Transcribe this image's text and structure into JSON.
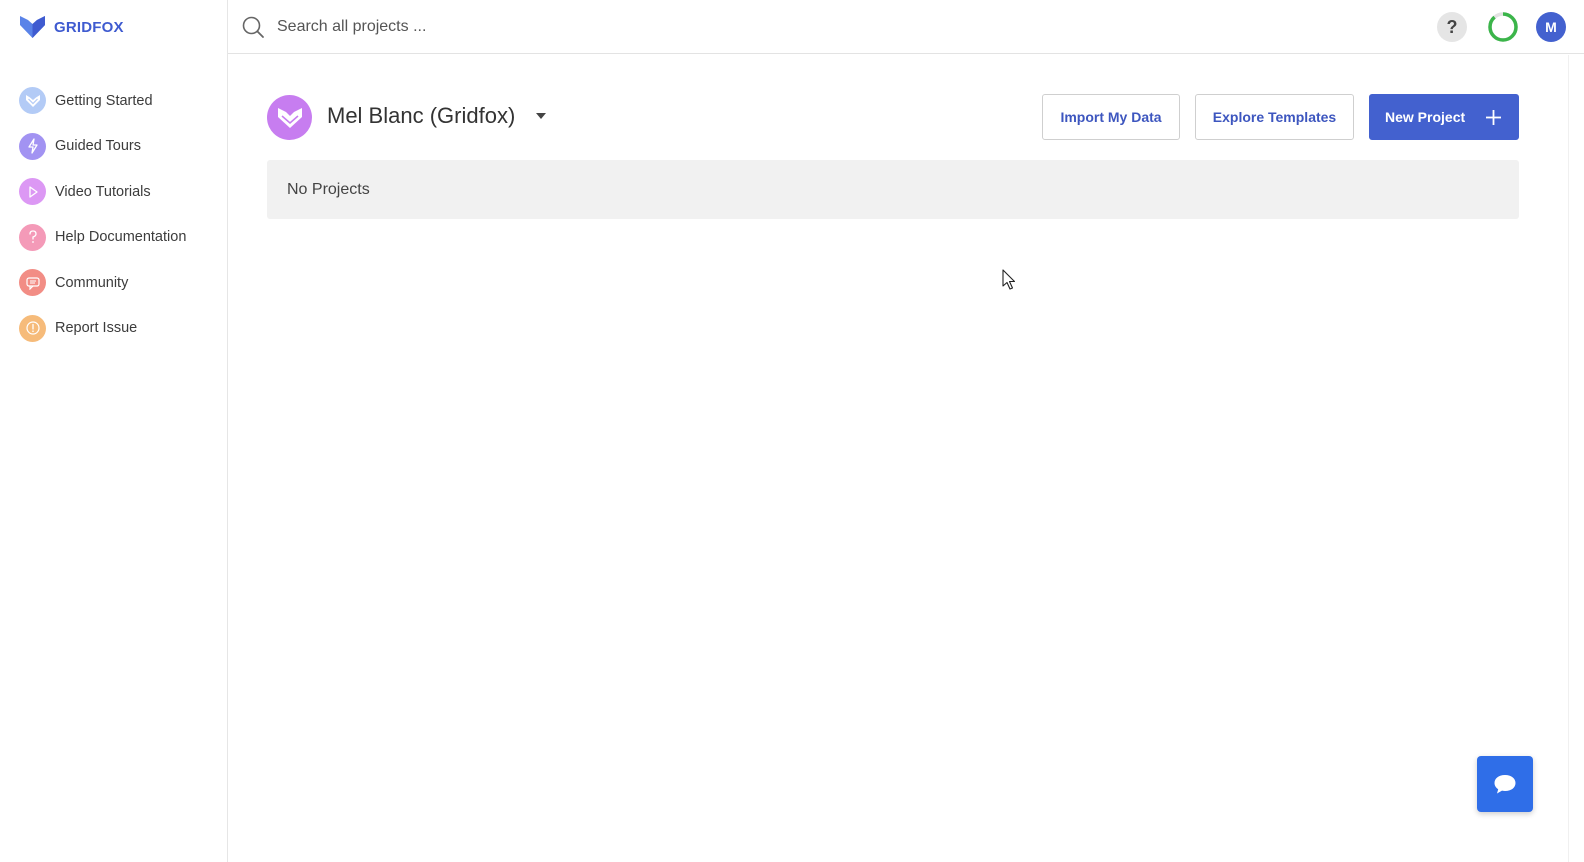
{
  "brand": {
    "name": "GRIDFOX"
  },
  "search": {
    "placeholder": "Search all projects ..."
  },
  "topbar": {
    "help_label": "?",
    "avatar_initial": "M"
  },
  "sidebar": {
    "items": [
      {
        "label": "Getting Started",
        "icon": "gridfox-logo-icon",
        "color": "#a7c4f5"
      },
      {
        "label": "Guided Tours",
        "icon": "lightning-icon",
        "color": "#9b8cf0"
      },
      {
        "label": "Video Tutorials",
        "icon": "play-icon",
        "color": "#d58cf2"
      },
      {
        "label": "Help Documentation",
        "icon": "question-icon",
        "color": "#f28fb0"
      },
      {
        "label": "Community",
        "icon": "chat-bubble-icon",
        "color": "#f2847c"
      },
      {
        "label": "Report Issue",
        "icon": "alert-icon",
        "color": "#f5b36e"
      }
    ]
  },
  "workspace": {
    "name": "Mel Blanc (Gridfox)"
  },
  "actions": {
    "import_label": "Import My Data",
    "templates_label": "Explore Templates",
    "new_project_label": "New Project"
  },
  "projects": {
    "empty_message": "No Projects"
  },
  "colors": {
    "accent": "#4361cf",
    "brand_text": "#3f5bd0",
    "progress_ring": "#3bb54a",
    "chat_button": "#2f6ee8",
    "workspace_avatar": "#c77df0"
  }
}
